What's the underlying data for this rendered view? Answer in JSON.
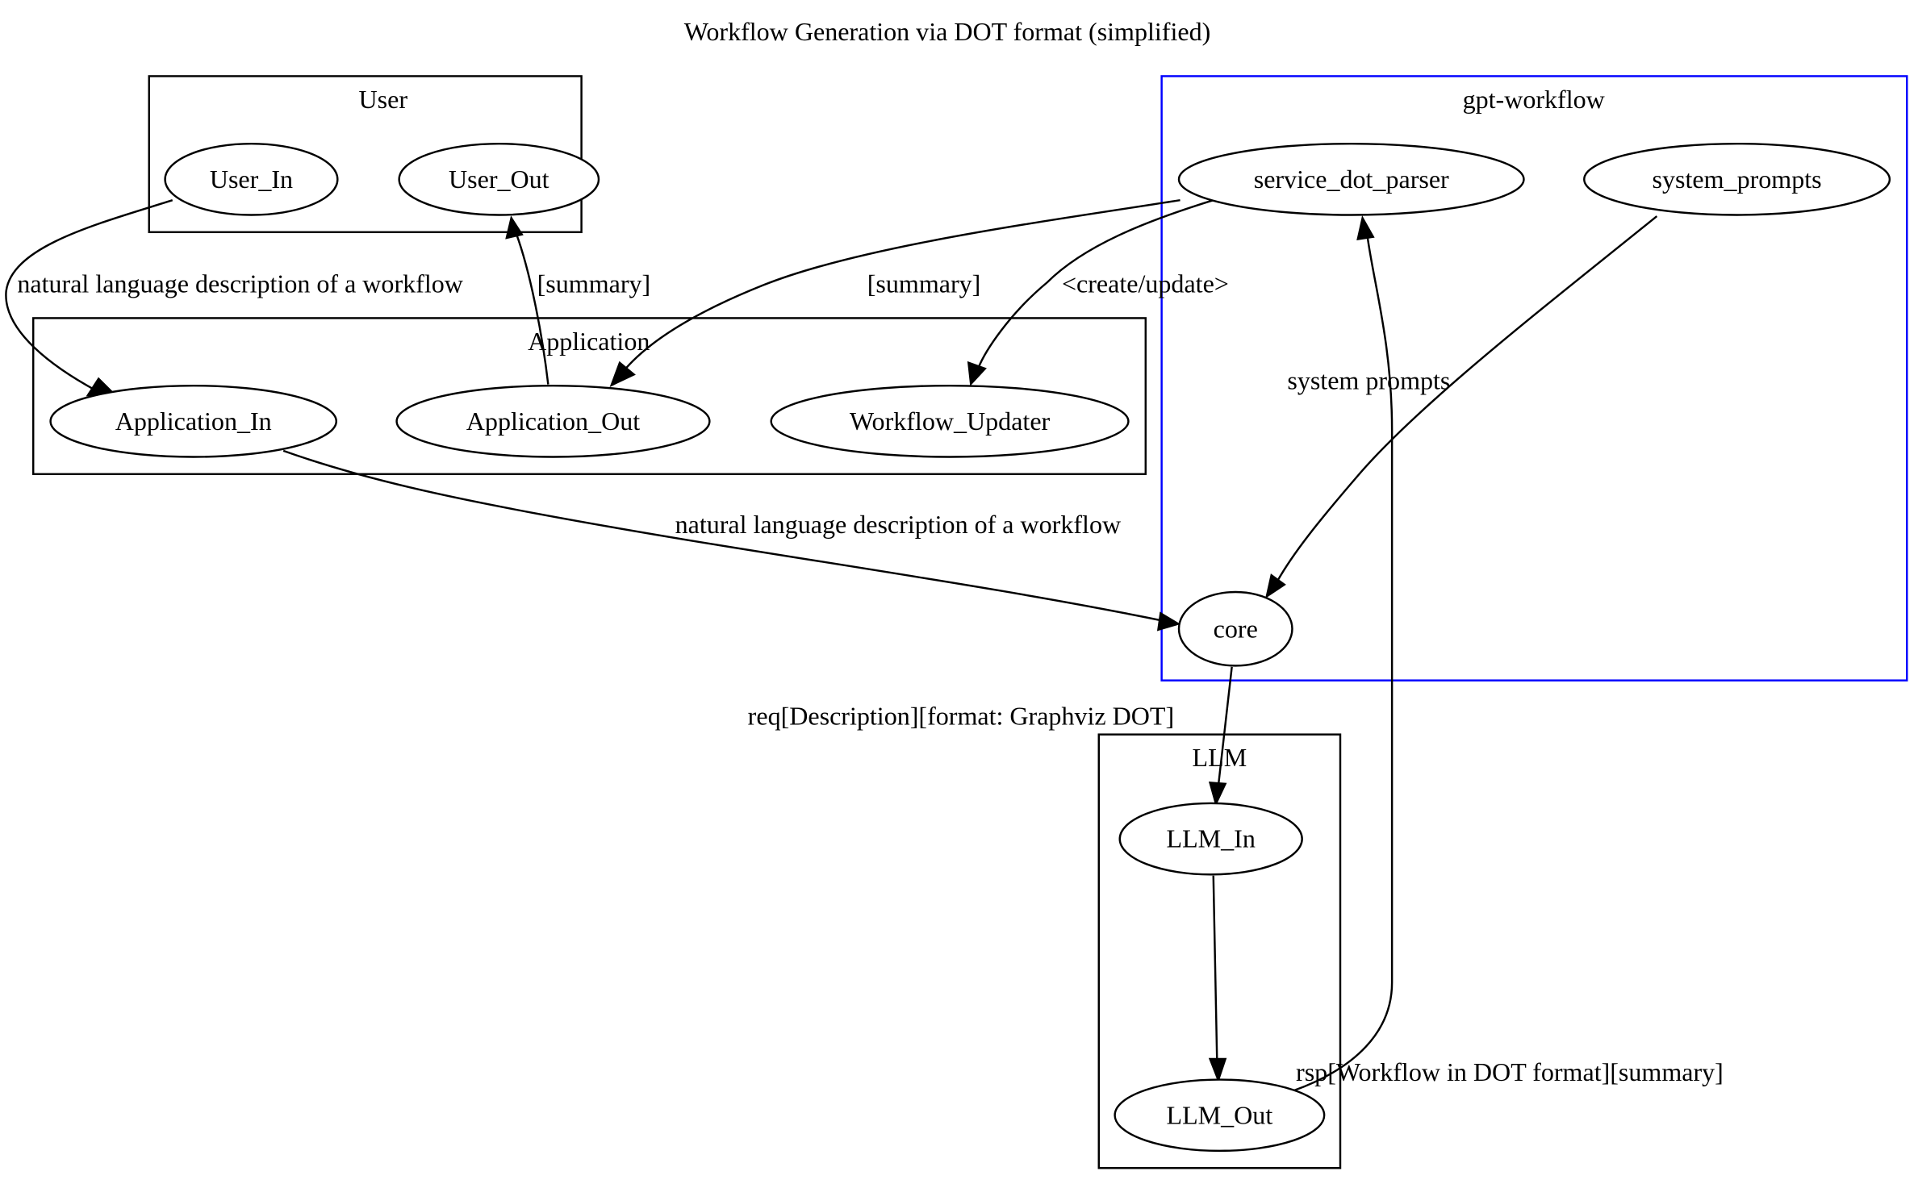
{
  "graph": {
    "title": "Workflow Generation via DOT format (simplified)",
    "clusters": [
      {
        "id": "user",
        "label": "User",
        "color": "#000000"
      },
      {
        "id": "application",
        "label": "Application",
        "color": "#000000"
      },
      {
        "id": "gpt_workflow",
        "label": "gpt-workflow",
        "color": "#0000ff"
      },
      {
        "id": "llm",
        "label": "LLM",
        "color": "#000000"
      }
    ],
    "nodes": [
      {
        "id": "User_In",
        "label": "User_In",
        "cluster": "user"
      },
      {
        "id": "User_Out",
        "label": "User_Out",
        "cluster": "user"
      },
      {
        "id": "Application_In",
        "label": "Application_In",
        "cluster": "application"
      },
      {
        "id": "Application_Out",
        "label": "Application_Out",
        "cluster": "application"
      },
      {
        "id": "Workflow_Updater",
        "label": "Workflow_Updater",
        "cluster": "application"
      },
      {
        "id": "service_dot_parser",
        "label": "service_dot_parser",
        "cluster": "gpt_workflow"
      },
      {
        "id": "system_prompts",
        "label": "system_prompts",
        "cluster": "gpt_workflow"
      },
      {
        "id": "core",
        "label": "core",
        "cluster": "gpt_workflow"
      },
      {
        "id": "LLM_In",
        "label": "LLM_In",
        "cluster": "llm"
      },
      {
        "id": "LLM_Out",
        "label": "LLM_Out",
        "cluster": "llm"
      }
    ],
    "edges": [
      {
        "from": "User_In",
        "to": "Application_In",
        "label": "natural language description of a workflow"
      },
      {
        "from": "Application_Out",
        "to": "User_Out",
        "label": "[summary]"
      },
      {
        "from": "service_dot_parser",
        "to": "Application_Out",
        "label": "[summary]"
      },
      {
        "from": "service_dot_parser",
        "to": "Workflow_Updater",
        "label": "<create/update>"
      },
      {
        "from": "system_prompts",
        "to": "core",
        "label": "system prompts"
      },
      {
        "from": "Application_In",
        "to": "core",
        "label": "natural language description of a workflow"
      },
      {
        "from": "core",
        "to": "LLM_In",
        "label": "req[Description][format: Graphviz DOT]"
      },
      {
        "from": "LLM_In",
        "to": "LLM_Out",
        "label": ""
      },
      {
        "from": "LLM_Out",
        "to": "service_dot_parser",
        "label": "rsp[Workflow in DOT format][summary]"
      }
    ]
  }
}
